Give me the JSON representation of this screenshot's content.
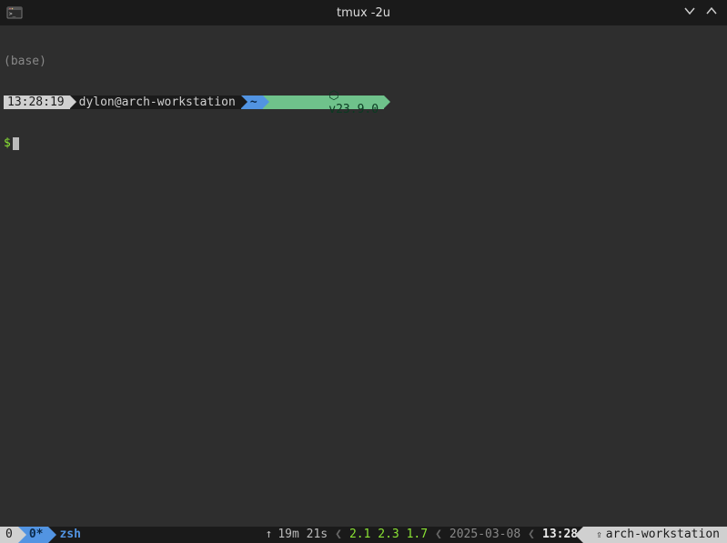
{
  "window": {
    "title": "tmux -2u"
  },
  "prompt": {
    "env": "(base)",
    "time": "13:28:19",
    "user_host": "dylon@arch-workstation",
    "cwd": "~",
    "node_version": "v23.9.0",
    "ps2": "$"
  },
  "status": {
    "session": "0",
    "window_index": "0*",
    "window_name": "zsh",
    "uptime": "19m 21s",
    "load_avg": "2.1 2.3 1.7",
    "date": "2025-03-08",
    "clock": "13:28",
    "hostname": "arch-workstation"
  },
  "icons": {
    "node_glyph": "⬡",
    "up_arrow": "↑",
    "lock": "⇪"
  }
}
